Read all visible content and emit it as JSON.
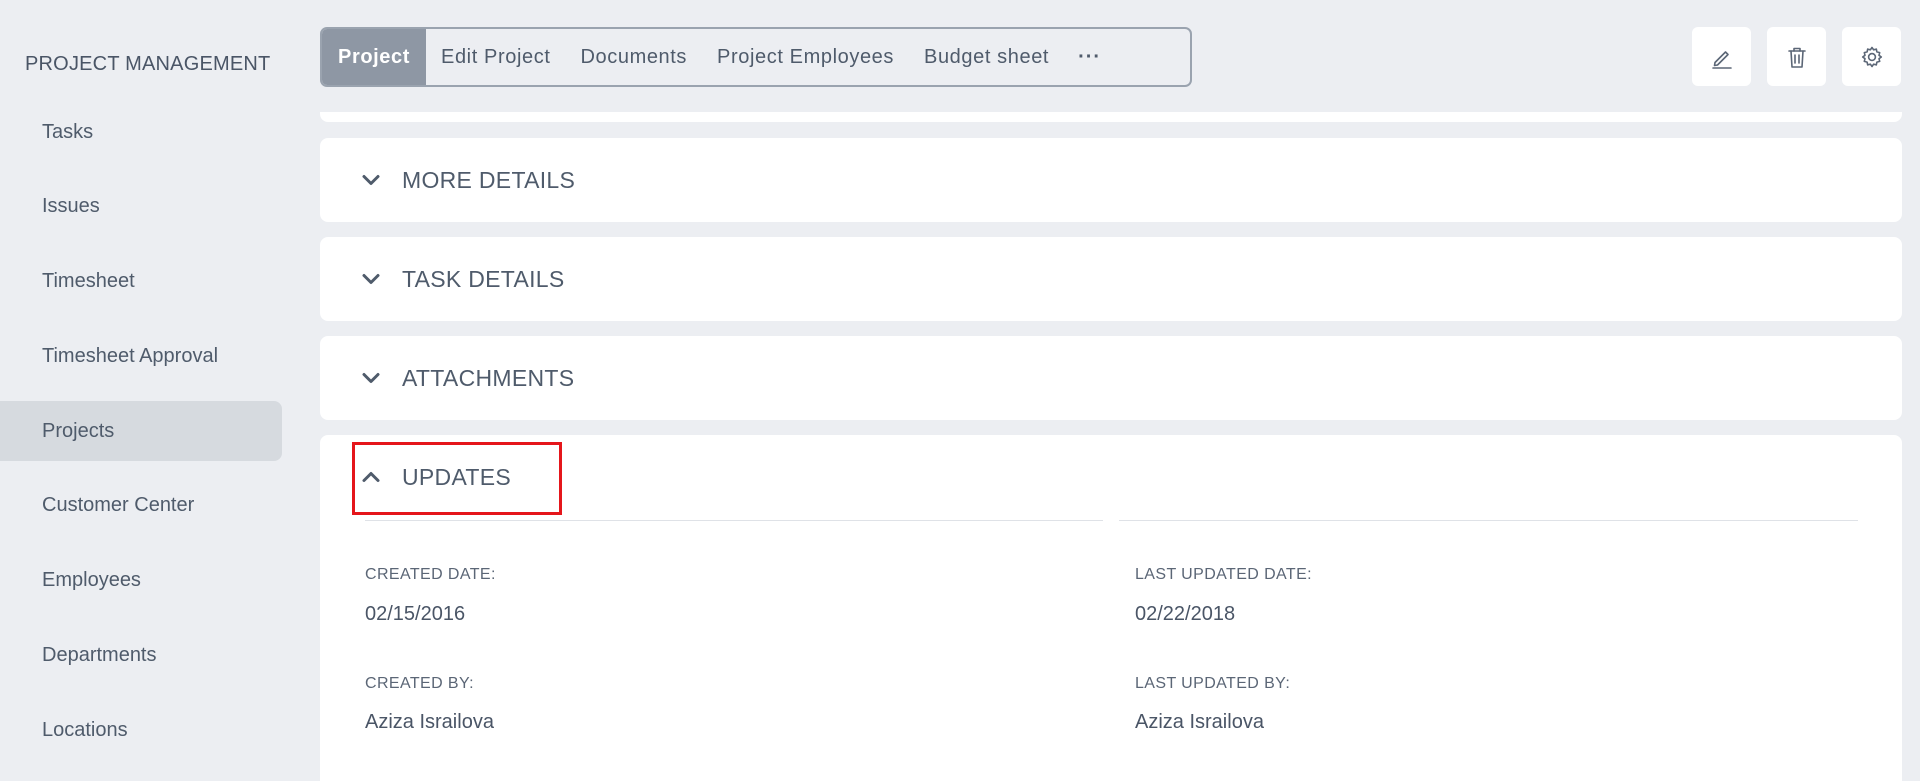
{
  "sidebar": {
    "title": "PROJECT MANAGEMENT",
    "items": [
      {
        "label": "Tasks"
      },
      {
        "label": "Issues"
      },
      {
        "label": "Timesheet"
      },
      {
        "label": "Timesheet Approval"
      },
      {
        "label": "Projects",
        "active": true
      },
      {
        "label": "Customer Center"
      },
      {
        "label": "Employees"
      },
      {
        "label": "Departments"
      },
      {
        "label": "Locations"
      }
    ]
  },
  "tabs": [
    {
      "label": "Project",
      "active": true
    },
    {
      "label": "Edit Project"
    },
    {
      "label": "Documents"
    },
    {
      "label": "Project Employees"
    },
    {
      "label": "Budget sheet"
    },
    {
      "label": "···"
    }
  ],
  "toolbar": {
    "icons": [
      "pencil-icon",
      "trash-icon",
      "gear-icon"
    ]
  },
  "sections": [
    {
      "title": "MORE DETAILS",
      "expanded": false
    },
    {
      "title": "TASK DETAILS",
      "expanded": false
    },
    {
      "title": "ATTACHMENTS",
      "expanded": false
    },
    {
      "title": "UPDATES",
      "expanded": true
    }
  ],
  "updates": {
    "created_date_label": "CREATED DATE:",
    "created_date": "02/15/2016",
    "last_updated_date_label": "LAST UPDATED DATE:",
    "last_updated_date": "02/22/2018",
    "created_by_label": "CREATED BY:",
    "created_by": "Aziza Israilova",
    "last_updated_by_label": "LAST UPDATED BY:",
    "last_updated_by": "Aziza Israilova"
  },
  "colors": {
    "background": "#eceef2",
    "active_tab": "#8e97a4",
    "active_nav": "#d6dadf",
    "highlight": "#e5161b",
    "text": "#4f5b6b"
  }
}
